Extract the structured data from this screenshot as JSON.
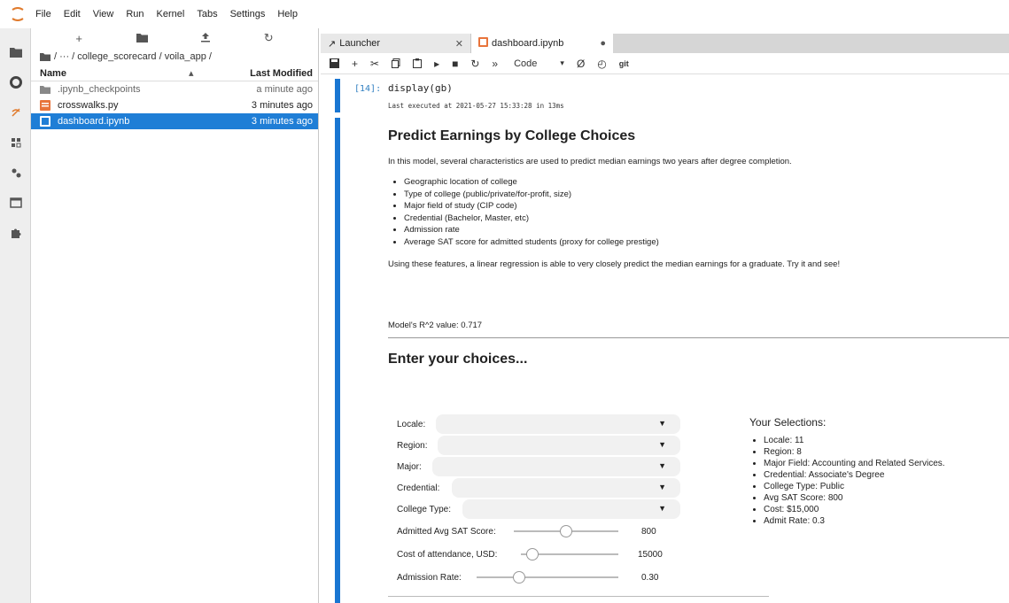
{
  "menu": [
    "File",
    "Edit",
    "View",
    "Run",
    "Kernel",
    "Tabs",
    "Settings",
    "Help"
  ],
  "rail_icons": [
    "folder-icon",
    "running-icon",
    "git-icon",
    "commands-icon",
    "property-inspector-icon",
    "tabs-icon",
    "extension-icon"
  ],
  "filebrowser": {
    "breadcrumb": "/ ··· / college_scorecard / voila_app /",
    "col_name": "Name",
    "col_modified": "Last Modified",
    "files": [
      {
        "name": ".ipynb_checkpoints",
        "modified": "a minute ago",
        "type": "folder"
      },
      {
        "name": "crosswalks.py",
        "modified": "3 minutes ago",
        "type": "python"
      },
      {
        "name": "dashboard.ipynb",
        "modified": "3 minutes ago",
        "type": "notebook"
      }
    ]
  },
  "tabs": {
    "launcher": "Launcher",
    "notebook": "dashboard.ipynb"
  },
  "toolbar": {
    "cell_type": "Code",
    "git_label": "git"
  },
  "cell": {
    "prompt": "[14]:",
    "code": "display(gb)",
    "executed": "Last executed at 2021-05-27 15:33:28 in 13ms"
  },
  "output": {
    "title": "Predict Earnings by College Choices",
    "intro": "In this model, several characteristics are used to predict median earnings two years after degree completion.",
    "bullets": [
      "Geographic location of college",
      "Type of college (public/private/for-profit, size)",
      "Major field of study (CIP code)",
      "Credential (Bachelor, Master, etc)",
      "Admission rate",
      "Average SAT score for admitted students (proxy for college prestige)"
    ],
    "conclusion": "Using these features, a linear regression is able to very closely predict the median earnings for a graduate. Try it and see!",
    "r2": "Model's R^2 value: 0.717",
    "choices_heading": "Enter your choices..."
  },
  "widgets": {
    "dropdowns": [
      {
        "label": "Locale:",
        "value": ""
      },
      {
        "label": "Region:",
        "value": ""
      },
      {
        "label": "Major:",
        "value": ""
      },
      {
        "label": "Credential:",
        "value": ""
      },
      {
        "label": "College Type:",
        "value": ""
      }
    ],
    "sliders": [
      {
        "label": "Admitted Avg SAT Score:",
        "value": "800",
        "fraction": 0.5
      },
      {
        "label": "Cost of attendance, USD:",
        "value": "15000",
        "fraction": 0.12
      },
      {
        "label": "Admission Rate:",
        "value": "0.30",
        "fraction": 0.3
      }
    ]
  },
  "selections": {
    "title": "Your Selections:",
    "items": [
      "Locale: 11",
      "Region: 8",
      "Major Field: Accounting and Related Services.",
      "Credential: Associate's Degree",
      "College Type: Public",
      "Avg SAT Score: 800",
      "Cost: $15,000",
      "Admit Rate: 0.3"
    ]
  }
}
